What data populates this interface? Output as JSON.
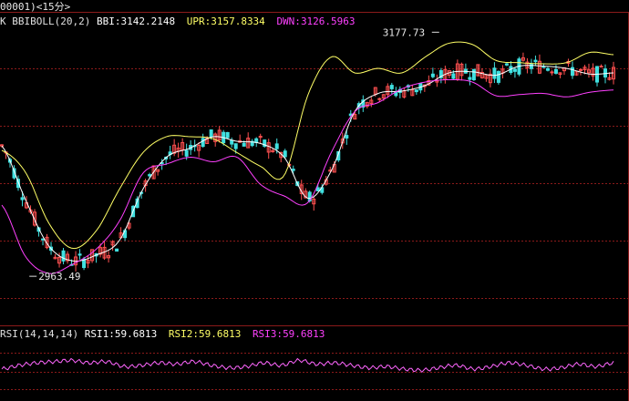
{
  "header": {
    "title": "00001)<15分>"
  },
  "main_panel": {
    "label_k": "K",
    "indicator": "BBIBOLL(20,2)",
    "bbi_label": "BBI:",
    "bbi_value": "3142.2148",
    "upr_label": "UPR:",
    "upr_value": "3157.8334",
    "dwn_label": "DWN:",
    "dwn_value": "3126.5963",
    "high_label": "3177.73",
    "low_label": "2963.49"
  },
  "rsi_panel": {
    "indicator": "RSI(14,14,14)",
    "rsi1_label": "RSI1:",
    "rsi1_value": "59.6813",
    "rsi2_label": "RSI2:",
    "rsi2_value": "59.6813",
    "rsi3_label": "RSI3:",
    "rsi3_value": "59.6813"
  },
  "colors": {
    "background": "#000000",
    "grid": "#8b1a1a",
    "up_candle": "#ff5050",
    "down_candle": "#40e0e0",
    "bbi_line": "#ffffff",
    "upr_line": "#ffff66",
    "dwn_line": "#ff40ff",
    "rsi_line": "#ff66ff"
  },
  "chart_data": {
    "type": "line",
    "series": [
      {
        "name": "BBI",
        "values": [
          3078,
          3031,
          2990,
          2977,
          2982,
          2995,
          3040,
          3068,
          3076,
          3086,
          3082,
          3080,
          3068,
          3032,
          3056,
          3108,
          3124,
          3126,
          3131,
          3142,
          3143,
          3140,
          3148,
          3148,
          3146,
          3141,
          3142
        ]
      },
      {
        "name": "UPR",
        "values": [
          3074,
          3055,
          3010,
          2988,
          3003,
          3040,
          3072,
          3086,
          3086,
          3084,
          3072,
          3060,
          3052,
          3122,
          3156,
          3142,
          3146,
          3142,
          3156,
          3168,
          3167,
          3153,
          3151,
          3150,
          3151,
          3160,
          3158
        ]
      },
      {
        "name": "DWN",
        "values": [
          3026,
          2981,
          2966,
          2974,
          2987,
          3012,
          3054,
          3062,
          3068,
          3064,
          3068,
          3044,
          3034,
          3028,
          3072,
          3108,
          3116,
          3128,
          3134,
          3136,
          3134,
          3122,
          3123,
          3124,
          3121,
          3125,
          3127
        ]
      }
    ],
    "annotations": [
      {
        "label": "3177.73",
        "kind": "high"
      },
      {
        "label": "2963.49",
        "kind": "low"
      }
    ],
    "rsi": [
      55,
      58,
      60,
      61,
      62,
      60,
      61,
      57,
      58,
      60,
      59,
      61,
      58,
      56,
      57,
      60,
      58,
      62,
      59,
      60,
      58,
      56,
      57,
      55,
      54,
      56,
      58,
      55,
      57,
      60,
      58,
      55,
      56,
      59,
      57,
      60
    ],
    "grid": true
  }
}
